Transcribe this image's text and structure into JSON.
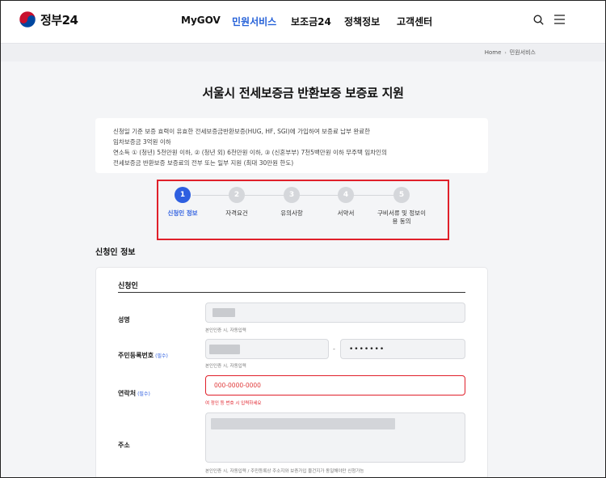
{
  "header": {
    "logo_text": "정부24",
    "nav": [
      {
        "label": "MyGOV"
      },
      {
        "label": "민원서비스"
      },
      {
        "label": "보조금24"
      },
      {
        "label": "정책정보"
      },
      {
        "label": "고객센터"
      }
    ],
    "search_icon": "search-icon",
    "menu_icon": "hamburger-menu-icon"
  },
  "breadcrumb": {
    "home": "Home",
    "current": "민원서비스"
  },
  "page_title": "서울시 전세보증금 반환보증 보증료 지원",
  "info": {
    "lines": [
      "신청일 기준 보증 효력이 유효한 전세보증금반환보증(HUG, HF, SGI)에 가입하여 보증료 납부 완료한",
      "임차보증금 3억원 이하",
      "연소득 ① (청년) 5천만원 이하, ② (청년 외) 6천만원 이하, ③ (신혼부부) 7천5백만원 이하 무주택 임차인의",
      "전세보증금 반환보증 보증료의 전부 또는 일부 지원 (최대 30만원 한도)"
    ]
  },
  "steps": [
    {
      "number": "1",
      "label": "신청인 정보",
      "active": true
    },
    {
      "number": "2",
      "label": "자격요건",
      "active": false
    },
    {
      "number": "3",
      "label": "유의사항",
      "active": false
    },
    {
      "number": "4",
      "label": "서약서",
      "active": false
    },
    {
      "number": "5",
      "label": "구비서류 및 정보이용 동의",
      "label_line1": "구비서류 및 정보이",
      "label_line2": "용 동의",
      "active": false
    }
  ],
  "section_title": "신청인 정보",
  "form": {
    "card_title": "신청인",
    "required_mark": "(필수)",
    "name": {
      "label": "성명",
      "hint": "본인인증 시, 자동입력"
    },
    "resident_number": {
      "label": "주민등록번호",
      "back_value": "•••••••",
      "dash": "-",
      "hint": "본인인증 시, 자동입력"
    },
    "phone": {
      "label": "연락처",
      "placeholder": "000-0000-0000",
      "error": "여 정인 등 번호 시 입력하세요"
    },
    "address": {
      "label": "주소",
      "hint": "본인인증 시, 자동입력 / 주민등록상 주소지와 보증가입 물건지가 동일해야만 신청가능"
    }
  },
  "colors": {
    "accent": "#2e5fe0",
    "highlight_border": "#e0202a",
    "page_bg": "#f4f5f7"
  }
}
